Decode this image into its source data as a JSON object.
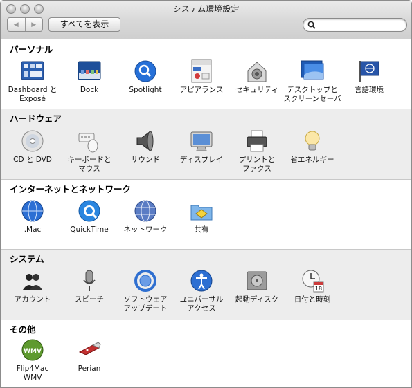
{
  "window": {
    "title": "システム環境設定"
  },
  "toolbar": {
    "back_label": "◀",
    "forward_label": "▶",
    "show_all_label": "すべてを表示",
    "search_value": ""
  },
  "sections": [
    {
      "title": "パーソナル",
      "items": [
        {
          "label": "Dashboard と\nExposé",
          "icon": "dashboard-expose-icon"
        },
        {
          "label": "Dock",
          "icon": "dock-icon"
        },
        {
          "label": "Spotlight",
          "icon": "spotlight-icon"
        },
        {
          "label": "アピアランス",
          "icon": "appearance-icon"
        },
        {
          "label": "セキュリティ",
          "icon": "security-icon"
        },
        {
          "label": "デスクトップと\nスクリーンセーバ",
          "icon": "desktop-screensaver-icon"
        },
        {
          "label": "言語環境",
          "icon": "international-icon"
        }
      ]
    },
    {
      "title": "ハードウェア",
      "items": [
        {
          "label": "CD と DVD",
          "icon": "cd-dvd-icon"
        },
        {
          "label": "キーボードと\nマウス",
          "icon": "keyboard-mouse-icon"
        },
        {
          "label": "サウンド",
          "icon": "sound-icon"
        },
        {
          "label": "ディスプレイ",
          "icon": "display-icon"
        },
        {
          "label": "プリントと\nファクス",
          "icon": "print-fax-icon"
        },
        {
          "label": "省エネルギー",
          "icon": "energy-saver-icon"
        }
      ]
    },
    {
      "title": "インターネットとネットワーク",
      "items": [
        {
          "label": ".Mac",
          "icon": "dotmac-icon"
        },
        {
          "label": "QuickTime",
          "icon": "quicktime-icon"
        },
        {
          "label": "ネットワーク",
          "icon": "network-icon"
        },
        {
          "label": "共有",
          "icon": "sharing-icon"
        }
      ]
    },
    {
      "title": "システム",
      "items": [
        {
          "label": "アカウント",
          "icon": "accounts-icon"
        },
        {
          "label": "スピーチ",
          "icon": "speech-icon"
        },
        {
          "label": "ソフトウェア\nアップデート",
          "icon": "software-update-icon"
        },
        {
          "label": "ユニバーサル\nアクセス",
          "icon": "universal-access-icon"
        },
        {
          "label": "起動ディスク",
          "icon": "startup-disk-icon"
        },
        {
          "label": "日付と時刻",
          "icon": "date-time-icon"
        }
      ]
    },
    {
      "title": "その他",
      "items": [
        {
          "label": "Flip4Mac\nWMV",
          "icon": "flip4mac-icon",
          "badge": "WMV"
        },
        {
          "label": "Perian",
          "icon": "perian-icon"
        }
      ]
    }
  ],
  "date_time_icon_day": "18"
}
